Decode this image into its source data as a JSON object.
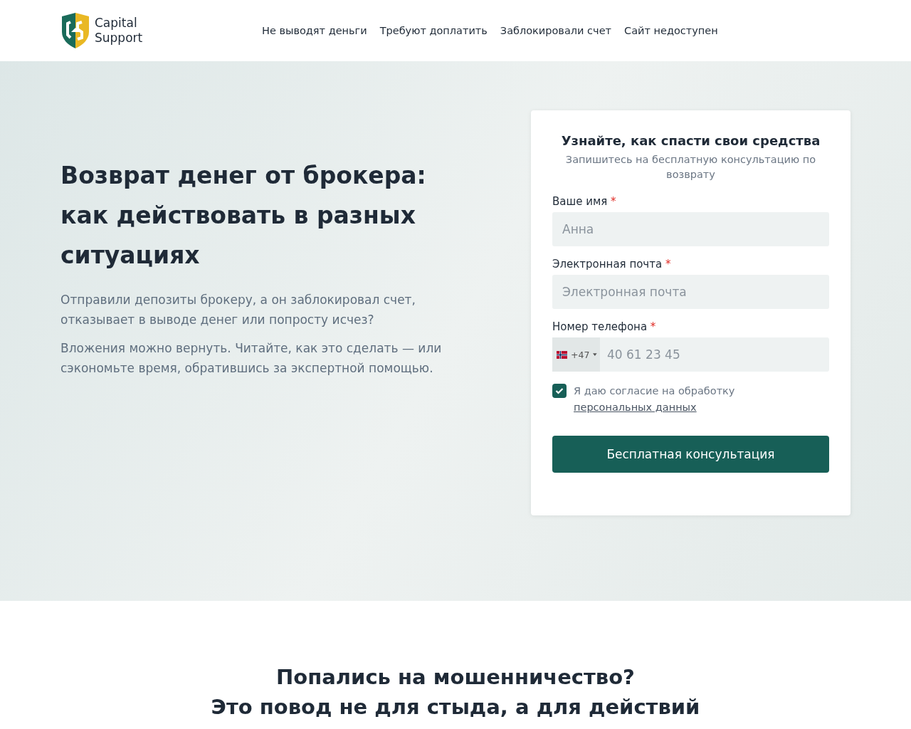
{
  "header": {
    "logo_text": [
      "Capital",
      "Support"
    ],
    "nav": [
      {
        "label": "Не выводят деньги"
      },
      {
        "label": "Требуют доплатить"
      },
      {
        "label": "Заблокировали счет"
      },
      {
        "label": "Сайт недоступен"
      }
    ]
  },
  "hero": {
    "title_lines": [
      "Возврат денег от брокера:",
      "как действовать в разных ситуациях"
    ],
    "paragraphs": [
      "Отправили депозиты брокеру, а он заблокировал счет, отказывает в выводе денег или попросту исчез?",
      "Вложения можно вернуть. Читайте, как это сделать — или сэкономьте время, обратившись за экспертной помощью."
    ]
  },
  "form": {
    "title": "Узнайте, как спасти свои средства",
    "subtitle": "Запишитесь на бесплатную консультацию по возврату",
    "fields": [
      {
        "kind": "text",
        "label": "Ваше имя",
        "required_mark": "*",
        "placeholder": "Анна"
      },
      {
        "kind": "text",
        "label": "Электронная почта",
        "required_mark": "*",
        "placeholder": "Электронная почта"
      },
      {
        "kind": "phone",
        "label": "Номер телефона",
        "required_mark": "*",
        "country_code": "+47",
        "placeholder": "40 61 23 45"
      }
    ],
    "consent": {
      "checked": true,
      "text": "Я даю согласие на обработку",
      "link": "персональных данных"
    },
    "submit": "Бесплатная консультация"
  },
  "section": {
    "title_lines": [
      "Попались на мошенничество?",
      "Это повод не для стыда, а для действий"
    ]
  }
}
